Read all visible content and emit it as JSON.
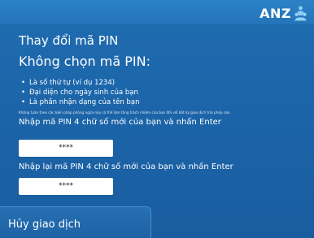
{
  "brand": {
    "name": "ANZ"
  },
  "screen": {
    "title": "Thay đổi mã PIN",
    "subtitle": "Không chọn mã PIN:",
    "rules": [
      "Là số thứ tự (ví dụ 1234)",
      "Đại diện cho ngày sinh của bạn",
      "Là phần nhận dạng của tên bạn"
    ],
    "disclaimer": "Không tuân theo các biện pháp phòng ngừa này có thể làm tăng trách nhiệm của bạn đối với bất kỳ giao dịch trái phép nào"
  },
  "new_pin": {
    "prompt": "Nhập mã PIN 4 chữ số mới của bạn và nhấn Enter",
    "masked_value": "****"
  },
  "confirm_pin": {
    "prompt": "Nhập lại mã PIN 4 chữ số mới của bạn và nhấn Enter",
    "masked_value": "****"
  },
  "cancel_button": {
    "label": "Hủy giao dịch"
  },
  "colors": {
    "background": "#1b63a7",
    "top_bar": "#2474b9",
    "text": "#ffffff",
    "logo_accent": "#8fd0f5"
  }
}
